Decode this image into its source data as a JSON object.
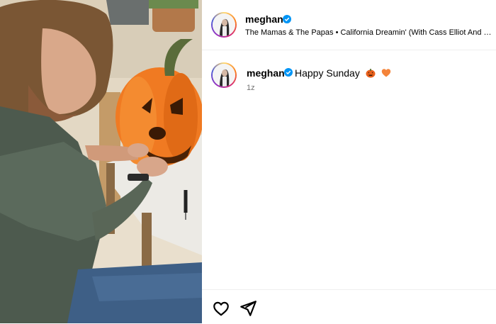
{
  "post": {
    "photo": {
      "alt_icon": "pumpkin-carving-photo",
      "colors": {
        "pumpkin": "#f07a22",
        "stem": "#5a6b3a",
        "jacket": "#4d5a4e",
        "jeans": "#3e5f86",
        "table": "#e8e4dc"
      }
    },
    "header": {
      "username": "meghan",
      "verified_icon": "verified-badge-icon",
      "audio": "The Mamas & The Papas • California Dreamin' (With Cass Elliot And John Phillips)"
    },
    "caption": {
      "username": "meghan",
      "text": "Happy Sunday",
      "emojis": [
        "jack-o-lantern",
        "orange-heart"
      ],
      "timestamp": "1z"
    },
    "actions": {
      "like_icon": "heart-icon",
      "share_icon": "paper-plane-icon"
    },
    "theme": {
      "verified_color": "#0095f6",
      "muted_text": "#737373"
    }
  }
}
